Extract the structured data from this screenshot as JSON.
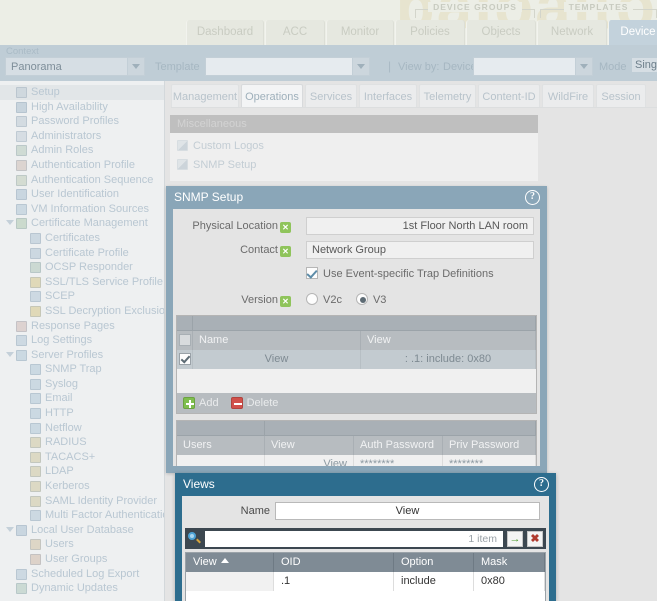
{
  "masthead": {
    "group_labels": [
      {
        "text": "DEVICE GROUPS"
      },
      {
        "text": "TEMPLATES"
      }
    ],
    "nav_tabs": [
      {
        "label": "Dashboard",
        "active": false
      },
      {
        "label": "ACC",
        "active": false
      },
      {
        "label": "Monitor",
        "active": false
      },
      {
        "label": "Policies",
        "active": false
      },
      {
        "label": "Objects",
        "active": false
      },
      {
        "label": "Network",
        "active": false
      },
      {
        "label": "Device",
        "active": true
      }
    ],
    "watermark": "paloalto"
  },
  "context_bar": {
    "context_label": "Context",
    "context_value": "Panorama",
    "template_label": "Template",
    "template_value": "",
    "divider": "|",
    "viewby_label": "View by:",
    "device_label": "Device",
    "device_value": "",
    "mode_label": "Mode",
    "mode_value": "Sing"
  },
  "sidebar": {
    "items": [
      {
        "label": "Setup",
        "level": 0,
        "icon": "setup-icon",
        "selected": true,
        "twisty": false,
        "color": "#cfd8de"
      },
      {
        "label": "High Availability",
        "level": 0,
        "icon": "high-availability-icon",
        "selected": false,
        "twisty": false,
        "color": "#c8d4dd"
      },
      {
        "label": "Password Profiles",
        "level": 0,
        "icon": "password-profiles-icon",
        "selected": false,
        "twisty": false,
        "color": "#d3dbe1"
      },
      {
        "label": "Administrators",
        "level": 0,
        "icon": "administrators-icon",
        "selected": false,
        "twisty": false,
        "color": "#d6dde3"
      },
      {
        "label": "Admin Roles",
        "level": 0,
        "icon": "admin-roles-icon",
        "selected": false,
        "twisty": false,
        "color": "#cfdbd4"
      },
      {
        "label": "Authentication Profile",
        "level": 0,
        "icon": "authentication-profile-icon",
        "selected": false,
        "twisty": false,
        "color": "#dcd4d0"
      },
      {
        "label": "Authentication Sequence",
        "level": 0,
        "icon": "authentication-sequence-icon",
        "selected": false,
        "twisty": false,
        "color": "#d4dcd2"
      },
      {
        "label": "User Identification",
        "level": 0,
        "icon": "user-identification-icon",
        "selected": false,
        "twisty": false,
        "color": "#c9d6e0"
      },
      {
        "label": "VM Information Sources",
        "level": 0,
        "icon": "vm-information-sources-icon",
        "selected": false,
        "twisty": false,
        "color": "#ccd9e2"
      },
      {
        "label": "Certificate Management",
        "level": 0,
        "icon": "certificate-management-icon",
        "selected": false,
        "twisty": true,
        "color": "#cbdacd"
      },
      {
        "label": "Certificates",
        "level": 1,
        "icon": "certificates-icon",
        "selected": false,
        "twisty": false,
        "color": "#ccd8e1"
      },
      {
        "label": "Certificate Profile",
        "level": 1,
        "icon": "certificate-profile-icon",
        "selected": false,
        "twisty": false,
        "color": "#ccd8e1"
      },
      {
        "label": "OCSP Responder",
        "level": 1,
        "icon": "ocsp-responder-icon",
        "selected": false,
        "twisty": false,
        "color": "#cbd9d2"
      },
      {
        "label": "SSL/TLS Service Profile",
        "level": 1,
        "icon": "ssl-tls-service-profile-icon",
        "selected": false,
        "twisty": false,
        "color": "#e0d9b8"
      },
      {
        "label": "SCEP",
        "level": 1,
        "icon": "scep-icon",
        "selected": false,
        "twisty": false,
        "color": "#cdd9e2"
      },
      {
        "label": "SSL Decryption Exclusion",
        "level": 1,
        "icon": "ssl-decryption-exclusion-icon",
        "selected": false,
        "twisty": false,
        "color": "#e0d9b8"
      },
      {
        "label": "Response Pages",
        "level": 0,
        "icon": "response-pages-icon",
        "selected": false,
        "twisty": false,
        "color": "#ddd2d0"
      },
      {
        "label": "Log Settings",
        "level": 0,
        "icon": "log-settings-icon",
        "selected": false,
        "twisty": false,
        "color": "#cdd9e2"
      },
      {
        "label": "Server Profiles",
        "level": 0,
        "icon": "server-profiles-icon",
        "selected": false,
        "twisty": true,
        "color": "#cbd9e2"
      },
      {
        "label": "SNMP Trap",
        "level": 1,
        "icon": "snmp-trap-icon",
        "selected": false,
        "twisty": false,
        "color": "#cbd9e2"
      },
      {
        "label": "Syslog",
        "level": 1,
        "icon": "syslog-icon",
        "selected": false,
        "twisty": false,
        "color": "#cbd9e2"
      },
      {
        "label": "Email",
        "level": 1,
        "icon": "email-icon",
        "selected": false,
        "twisty": false,
        "color": "#cbd9e2"
      },
      {
        "label": "HTTP",
        "level": 1,
        "icon": "http-icon",
        "selected": false,
        "twisty": false,
        "color": "#cbd9e2"
      },
      {
        "label": "Netflow",
        "level": 1,
        "icon": "netflow-icon",
        "selected": false,
        "twisty": false,
        "color": "#cbd9e2"
      },
      {
        "label": "RADIUS",
        "level": 1,
        "icon": "radius-icon",
        "selected": false,
        "twisty": false,
        "color": "#dcd9c4"
      },
      {
        "label": "TACACS+",
        "level": 1,
        "icon": "tacacs-icon",
        "selected": false,
        "twisty": false,
        "color": "#dcd9c4"
      },
      {
        "label": "LDAP",
        "level": 1,
        "icon": "ldap-icon",
        "selected": false,
        "twisty": false,
        "color": "#dcd9c4"
      },
      {
        "label": "Kerberos",
        "level": 1,
        "icon": "kerberos-icon",
        "selected": false,
        "twisty": false,
        "color": "#dcd9c4"
      },
      {
        "label": "SAML Identity Provider",
        "level": 1,
        "icon": "saml-identity-provider-icon",
        "selected": false,
        "twisty": false,
        "color": "#dcd9c4"
      },
      {
        "label": "Multi Factor Authentication",
        "level": 1,
        "icon": "multi-factor-authentication-icon",
        "selected": false,
        "twisty": false,
        "color": "#ccd9e2"
      },
      {
        "label": "Local User Database",
        "level": 0,
        "icon": "local-user-database-icon",
        "selected": false,
        "twisty": true,
        "color": "#c9d6e0"
      },
      {
        "label": "Users",
        "level": 1,
        "icon": "users-icon",
        "selected": false,
        "twisty": false,
        "color": "#ddd6c6"
      },
      {
        "label": "User Groups",
        "level": 1,
        "icon": "user-groups-icon",
        "selected": false,
        "twisty": false,
        "color": "#ddd2c9"
      },
      {
        "label": "Scheduled Log Export",
        "level": 0,
        "icon": "scheduled-log-export-icon",
        "selected": false,
        "twisty": false,
        "color": "#cdd9e2"
      },
      {
        "label": "Dynamic Updates",
        "level": 0,
        "icon": "dynamic-updates-icon",
        "selected": false,
        "twisty": false,
        "color": "#cbdad4"
      }
    ]
  },
  "subtabs": [
    {
      "label": "Management",
      "active": false
    },
    {
      "label": "Operations",
      "active": true
    },
    {
      "label": "Services",
      "active": false
    },
    {
      "label": "Interfaces",
      "active": false
    },
    {
      "label": "Telemetry",
      "active": false
    },
    {
      "label": "Content-ID",
      "active": false
    },
    {
      "label": "WildFire",
      "active": false
    },
    {
      "label": "Session",
      "active": false
    }
  ],
  "misc_panel": {
    "header": "Miscellaneous",
    "links": [
      {
        "label": "Custom Logos",
        "icon": "custom-logos-icon"
      },
      {
        "label": "SNMP Setup",
        "icon": "snmp-setup-icon"
      }
    ]
  },
  "snmp_dialog": {
    "title": "SNMP Setup",
    "help_glyph": "?",
    "fields": {
      "physical_location_label": "Physical Location",
      "physical_location_value": "1st Floor North LAN room",
      "physical_location_placeholder": "",
      "contact_label": "Contact",
      "contact_value": "Network Group",
      "contact_placeholder": "",
      "trap_defs_label": "Use Event-specific Trap Definitions",
      "trap_defs_checked": true,
      "version_label": "Version",
      "version_options": [
        {
          "label": "V2c",
          "selected": false
        },
        {
          "label": "V3",
          "selected": true
        }
      ]
    },
    "views_grid": {
      "columns": [
        "",
        "Name",
        "View"
      ],
      "rows": [
        {
          "checked": true,
          "name": "View",
          "view_sep": ":",
          "view": ": .1: include: 0x80"
        }
      ],
      "actions": [
        {
          "label": "Add",
          "icon": "plus-icon"
        },
        {
          "label": "Delete",
          "icon": "minus-icon"
        }
      ]
    },
    "users_grid": {
      "columns": [
        "Users",
        "View",
        "Auth Password",
        "Priv Password"
      ],
      "rows": [
        {
          "users": "",
          "view": "View",
          "auth_password": "********",
          "priv_password": "********"
        }
      ]
    }
  },
  "views_dialog": {
    "title": "Views",
    "help_glyph": "?",
    "name_label": "Name",
    "name_value": "View",
    "name_placeholder": "",
    "search_value": "",
    "search_placeholder": "",
    "item_count": "1 item",
    "go_glyph": "→",
    "clear_glyph": "✖",
    "grid": {
      "columns": [
        "View",
        "OID",
        "Option",
        "Mask"
      ],
      "sort_column": "View",
      "sort_direction": "asc",
      "rows": [
        {
          "view": "",
          "oid": ".1",
          "option": "include",
          "mask": "0x80"
        }
      ]
    }
  },
  "colors": {
    "masthead_bg": "#eceee6",
    "context_bg": "#bfcdd6",
    "snmp_header": "#8aa6b8",
    "views_header": "#2d6d8e",
    "search_bar": "#3c4750",
    "accent_green": "#8fc45b",
    "accent_red": "#d1504a",
    "page_bg": "#e4e4e4"
  }
}
